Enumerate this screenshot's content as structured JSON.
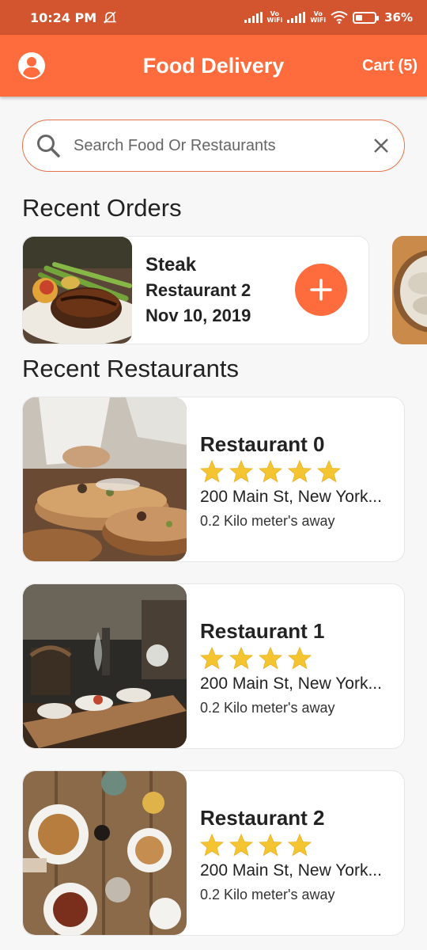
{
  "status_bar": {
    "time": "10:24 PM",
    "battery": "36%"
  },
  "app_bar": {
    "title": "Food Delivery",
    "cart_label": "Cart (5)"
  },
  "search": {
    "placeholder": "Search Food Or Restaurants"
  },
  "recent_orders": {
    "title": "Recent Orders",
    "items": [
      {
        "food": "Steak",
        "restaurant": "Restaurant 2",
        "date": "Nov 10, 2019"
      }
    ]
  },
  "recent_restaurants": {
    "title": "Recent Restaurants",
    "items": [
      {
        "name": "Restaurant 0",
        "rating": 5,
        "address": "200 Main St, New York...",
        "distance": "0.2 Kilo meter's away"
      },
      {
        "name": "Restaurant 1",
        "rating": 4,
        "address": "200 Main St, New York...",
        "distance": "0.2 Kilo meter's away"
      },
      {
        "name": "Restaurant 2",
        "rating": 4,
        "address": "200 Main St, New York...",
        "distance": "0.2 Kilo meter's away"
      }
    ]
  },
  "colors": {
    "accent": "#fe6c3d",
    "status_bar": "#d3552f",
    "star": "#f5c431"
  }
}
